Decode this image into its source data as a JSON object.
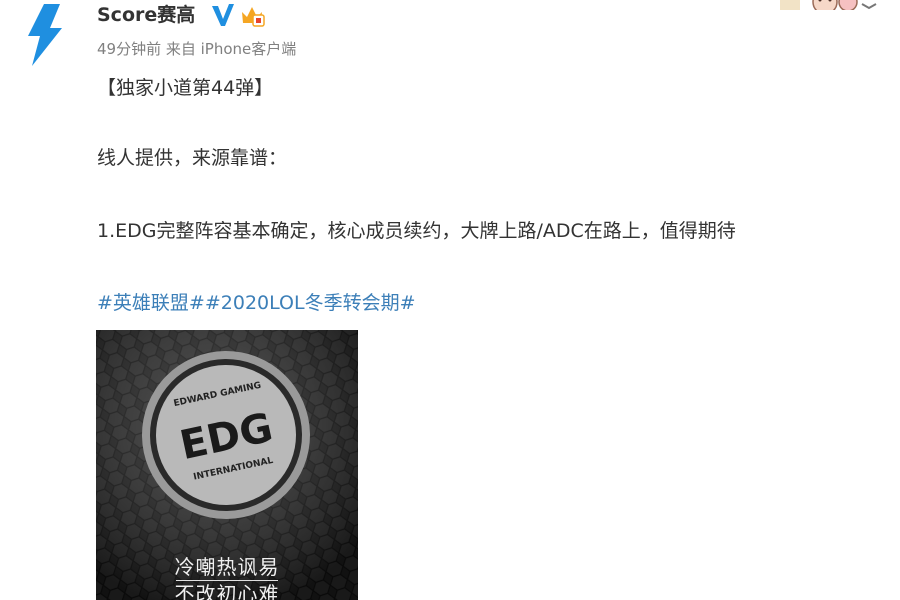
{
  "post": {
    "author": "Score赛高",
    "meta": "49分钟前 来自 iPhone客户端",
    "title_line": "【独家小道第44弹】",
    "intro_line": "线人提供，来源靠谱：",
    "item_line": "1.EDG完整阵容基本确定，核心成员续约，大牌上路/ADC在路上，值得期待",
    "tags": [
      "#英雄联盟#",
      "#2020LOL冬季转会期#"
    ]
  },
  "image": {
    "logo_top": "EDWARD GAMING",
    "logo_main": "EDG",
    "logo_bottom": "INTERNATIONAL",
    "caption_line1": "冷嘲热讽易",
    "caption_line2": "不改初心难"
  },
  "icons": {
    "avatar": "lightning-bolt-icon",
    "verified": "verified-v-icon",
    "vip": "vip-crown-icon"
  },
  "colors": {
    "link": "#3c7fb8",
    "bolt": "#1f8fe0",
    "verified": "#1f8fe0",
    "vip": "#f5a623"
  }
}
